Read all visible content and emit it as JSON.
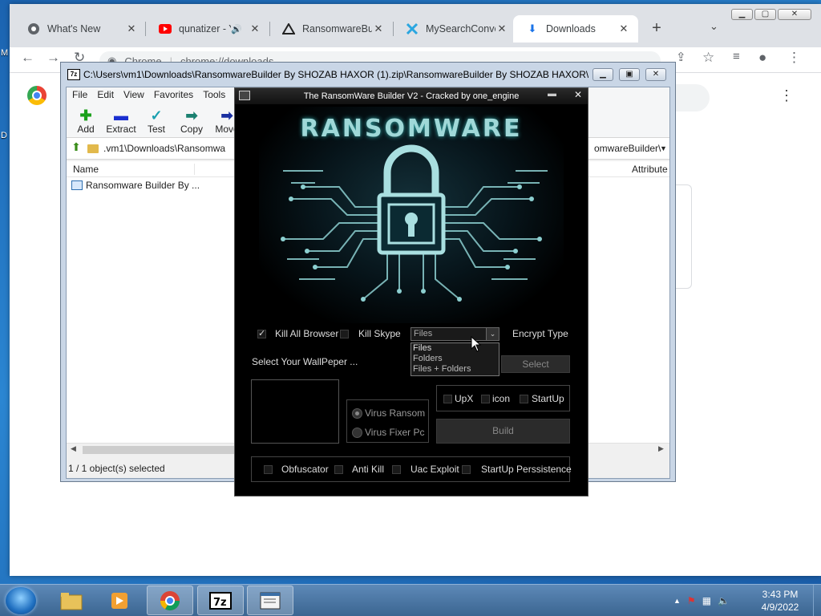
{
  "desktop": {
    "frag1": "M",
    "frag2": "D"
  },
  "chrome": {
    "tabs": [
      {
        "title": "What's New",
        "icon": "chrome-icon"
      },
      {
        "title": "qunatizer - Y",
        "icon": "youtube-icon"
      },
      {
        "title": "RansomwareBuil",
        "icon": "github-icon"
      },
      {
        "title": "MySearchConver",
        "icon": "search-conversion-icon"
      },
      {
        "title": "Downloads",
        "icon": "download-icon"
      }
    ],
    "omnibox": {
      "chip": "Chrome",
      "url": "chrome://downloads"
    }
  },
  "sevenzip": {
    "title": "C:\\Users\\vm1\\Downloads\\RansomwareBuilder By SHOZAB HAXOR (1).zip\\RansomwareBuilder By SHOZAB HAXOR\\R...",
    "menu": [
      "File",
      "Edit",
      "View",
      "Favorites",
      "Tools"
    ],
    "tools": [
      {
        "label": "Add",
        "icon": "+",
        "color": "#1aa01a"
      },
      {
        "label": "Extract",
        "icon": "−",
        "color": "#1a2fd0"
      },
      {
        "label": "Test",
        "icon": "✓",
        "color": "#1aa0b0"
      },
      {
        "label": "Copy",
        "icon": "➡",
        "color": "#1a8070"
      },
      {
        "label": "Move",
        "icon": "➡",
        "color": "#1a2fa0"
      }
    ],
    "path": ".vm1\\Downloads\\Ransomwa",
    "path_tail": "omwareBuilder\\",
    "columns": {
      "name": "Name",
      "attributes": "Attribute"
    },
    "row": "Ransomware Builder By ...",
    "status": "1 / 1 object(s) selected"
  },
  "builder": {
    "title": "The RansomWare Builder V2 - Cracked by one_engine",
    "banner": "RANSOMWARE",
    "kill_all_browser": "Kill All Browser",
    "kill_skype": "Kill Skype",
    "combo_value": "Files",
    "combo_options": [
      "Files",
      "Folders",
      "Files + Folders"
    ],
    "encrypt_type": "Encrypt Type",
    "wallpaper_label": "Select Your WallPeper ...",
    "select": "Select",
    "radio_ransom": "Virus Ransom",
    "radio_fixer": "Virus Fixer Pc",
    "opt_upx": "UpX",
    "opt_icon": "icon",
    "opt_startup": "StartUp",
    "build": "Build",
    "obfuscator": "Obfuscator",
    "anti_kill": "Anti Kill",
    "uac_exploit": "Uac Exploit",
    "startup_persistence": "StartUp Perssistence"
  },
  "taskbar": {
    "time": "3:43 PM",
    "date": "4/9/2022"
  }
}
